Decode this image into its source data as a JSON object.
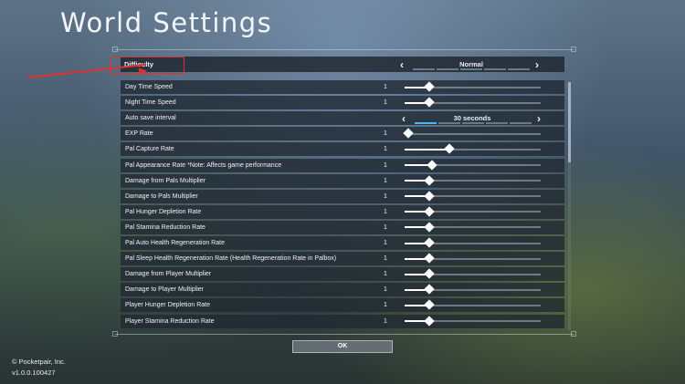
{
  "page": {
    "title": "World Settings"
  },
  "difficulty": {
    "label": "Difficulty",
    "value": "Normal",
    "segments": 5,
    "active_segment": -1
  },
  "rows": [
    {
      "label": "Day Time Speed",
      "value": "1",
      "type": "slider",
      "level": 0.18
    },
    {
      "label": "Night Time Speed",
      "value": "1",
      "type": "slider",
      "level": 0.18
    },
    {
      "label": "Auto save interval",
      "value": "30 seconds",
      "type": "select",
      "active_segment": 0
    },
    {
      "label": "EXP Rate",
      "value": "1",
      "type": "slider",
      "level": 0.03
    },
    {
      "label": "Pal Capture Rate",
      "value": "1",
      "type": "slider",
      "level": 0.33
    },
    {
      "label": "Pal Appearance Rate *Note: Affects game performance",
      "value": "1",
      "type": "slider",
      "level": 0.2
    },
    {
      "label": "Damage from Pals Multiplier",
      "value": "1",
      "type": "slider",
      "level": 0.18
    },
    {
      "label": "Damage to Pals Multiplier",
      "value": "1",
      "type": "slider",
      "level": 0.18
    },
    {
      "label": "Pal Hunger Depletion Rate",
      "value": "1",
      "type": "slider",
      "level": 0.18
    },
    {
      "label": "Pal Stamina Reduction Rate",
      "value": "1",
      "type": "slider",
      "level": 0.18
    },
    {
      "label": "Pal Auto Health Regeneration Rate",
      "value": "1",
      "type": "slider",
      "level": 0.18
    },
    {
      "label": "Pal Sleep Health Regeneration Rate (Health Regeneration Rate in Palbox)",
      "value": "1",
      "type": "slider",
      "level": 0.18
    },
    {
      "label": "Damage from Player Multiplier",
      "value": "1",
      "type": "slider",
      "level": 0.18
    },
    {
      "label": "Damage to Player Multiplier",
      "value": "1",
      "type": "slider",
      "level": 0.18
    },
    {
      "label": "Player Hunger Depletion Rate",
      "value": "1",
      "type": "slider",
      "level": 0.18
    },
    {
      "label": "Player Stamina Reduction Rate",
      "value": "1",
      "type": "slider",
      "level": 0.18
    }
  ],
  "ok_label": "OK",
  "footer": {
    "copyright": "© Pocketpair, Inc.",
    "version": "v1.0.0.100427"
  },
  "colors": {
    "accent": "#4ab7ff",
    "annotation": "#e23030"
  }
}
